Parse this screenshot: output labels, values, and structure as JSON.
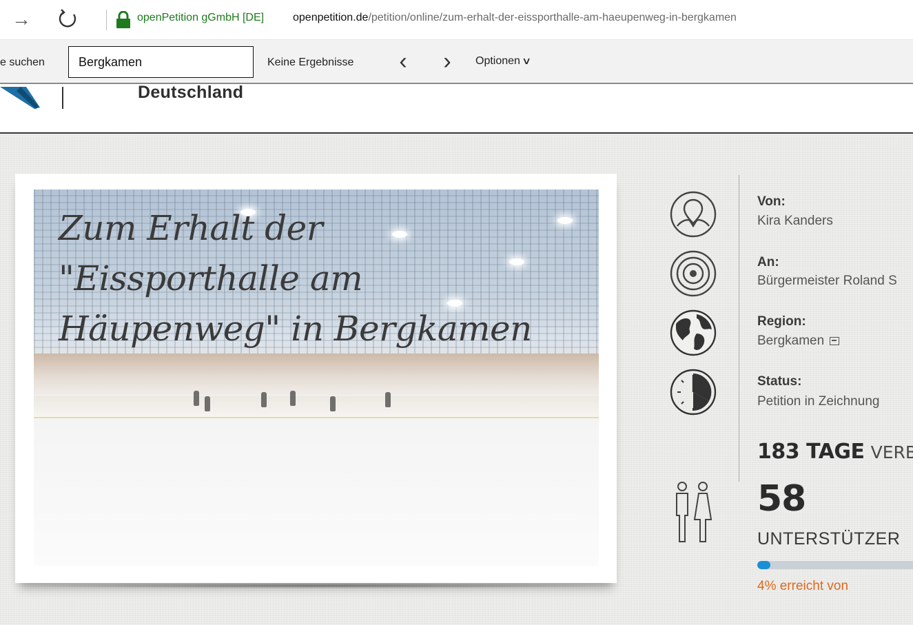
{
  "browser": {
    "site_identity": "openPetition gGmbH [DE]",
    "url_domain": "openpetition.de",
    "url_path": "/petition/online/zum-erhalt-der-eissporthalle-am-haeupenweg-in-bergkamen"
  },
  "find_bar": {
    "label": "e suchen",
    "query": "Bergkamen",
    "result": "Keine Ergebnisse",
    "options_label": "Optionen"
  },
  "site_header": {
    "subtitle": "Deutschland"
  },
  "petition": {
    "title_line1": "Zum Erhalt der",
    "title_line2": "\"Eissporthalle am",
    "title_line3": "Häupenweg\" in Bergkamen"
  },
  "info": {
    "from_label": "Von:",
    "from_value": "Kira Kanders",
    "to_label": "An:",
    "to_value": "Bürgermeister Roland S",
    "region_label": "Region:",
    "region_value": "Bergkamen",
    "status_label": "Status:",
    "status_value": "Petition in Zeichnung",
    "days_number": "183 TAGE",
    "days_text": "VERBLE"
  },
  "supporters": {
    "count": "58",
    "label": "UNTERSTÜTZER",
    "progress_percent": 4,
    "progress_text": "4% erreicht von"
  },
  "colors": {
    "site_identity": "#1e7a1e",
    "progress_fill": "#1a8fd6",
    "progress_text": "#e0691a"
  },
  "icons": [
    "forward-arrow-icon",
    "reload-icon",
    "lock-icon",
    "chevron-left-icon",
    "chevron-right-icon",
    "chevron-down-icon",
    "person-pin-icon",
    "target-icon",
    "globe-icon",
    "clock-icon",
    "external-link-icon",
    "supporters-icon"
  ]
}
